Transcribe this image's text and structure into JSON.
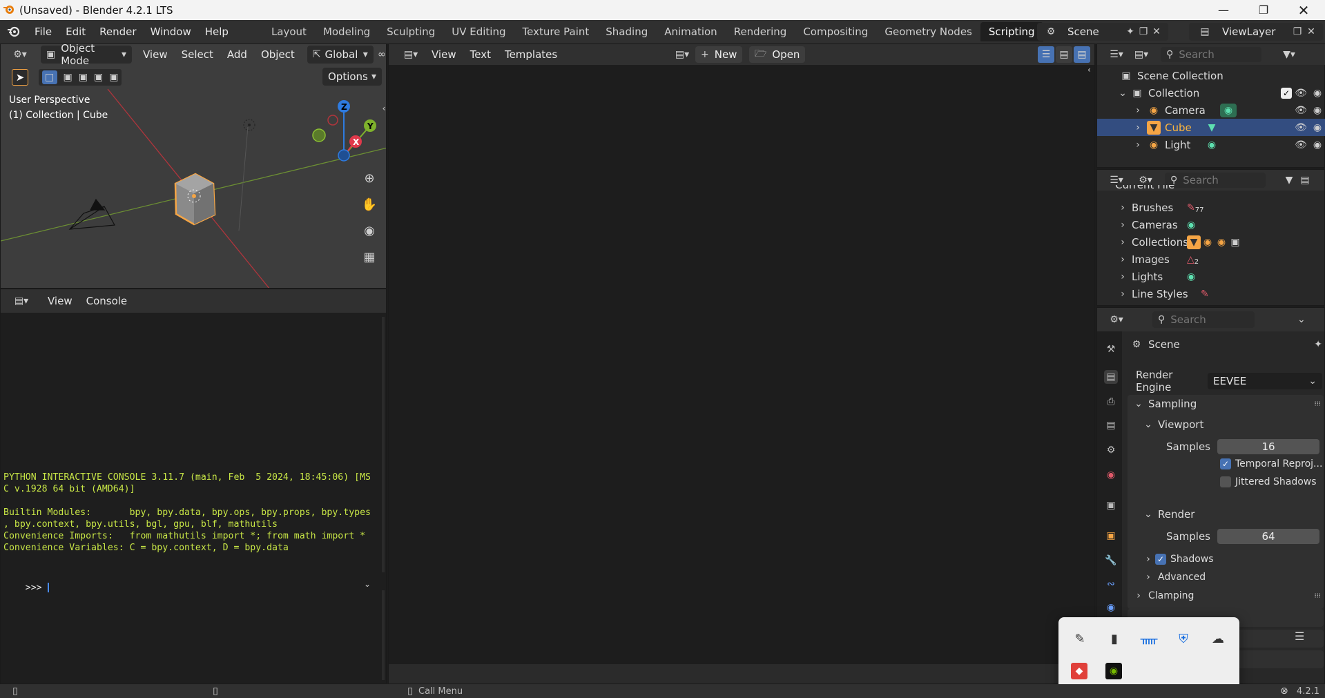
{
  "window": {
    "title": "(Unsaved) - Blender 4.2.1 LTS"
  },
  "menu": [
    "File",
    "Edit",
    "Render",
    "Window",
    "Help"
  ],
  "workspaces": [
    "Layout",
    "Modeling",
    "Sculpting",
    "UV Editing",
    "Texture Paint",
    "Shading",
    "Animation",
    "Rendering",
    "Compositing",
    "Geometry Nodes",
    "Scripting"
  ],
  "active_workspace": "Scripting",
  "scene": {
    "name": "Scene",
    "view_layer": "ViewLayer"
  },
  "viewport": {
    "mode": "Object Mode",
    "menus": [
      "View",
      "Select",
      "Add",
      "Object"
    ],
    "orientation": "Global",
    "options_label": "Options",
    "perspective_label": "User Perspective",
    "context_label": "(1) Collection | Cube"
  },
  "console": {
    "menus": [
      "View",
      "Console"
    ],
    "lines": [
      "PYTHON INTERACTIVE CONSOLE 3.11.7 (main, Feb  5 2024, 18:45:06) [MS",
      "C v.1928 64 bit (AMD64)]",
      "",
      "Builtin Modules:       bpy, bpy.data, bpy.ops, bpy.props, bpy.types",
      ", bpy.context, bpy.utils, bgl, gpu, blf, mathutils",
      "Convenience Imports:   from mathutils import *; from math import *",
      "Convenience Variables: C = bpy.context, D = bpy.data"
    ],
    "prompt": ">>> "
  },
  "text_editor": {
    "menus": [
      "View",
      "Text",
      "Templates"
    ],
    "new_label": "New",
    "open_label": "Open"
  },
  "outliner": {
    "search_placeholder": "Search",
    "scene_collection": "Scene Collection",
    "collection": "Collection",
    "items": [
      {
        "name": "Camera",
        "selected": false
      },
      {
        "name": "Cube",
        "selected": true
      },
      {
        "name": "Light",
        "selected": false
      }
    ]
  },
  "blender_file": {
    "search_placeholder": "Search",
    "current_label": "Current File",
    "items": [
      {
        "name": "Brushes",
        "badge": "77"
      },
      {
        "name": "Cameras",
        "badge": ""
      },
      {
        "name": "Collections",
        "badge": ""
      },
      {
        "name": "Images",
        "badge": "2"
      },
      {
        "name": "Lights",
        "badge": ""
      },
      {
        "name": "Line Styles",
        "badge": ""
      }
    ]
  },
  "properties": {
    "search_placeholder": "Search",
    "context_title": "Scene",
    "render_engine_label": "Render Engine",
    "render_engine_value": "EEVEE",
    "sampling_label": "Sampling",
    "viewport_label": "Viewport",
    "samples_label": "Samples",
    "viewport_samples": "16",
    "temporal_label": "Temporal Reproj...",
    "temporal_checked": true,
    "jittered_label": "Jittered Shadows",
    "jittered_checked": false,
    "render_label": "Render",
    "render_samples": "64",
    "shadows_label": "Shadows",
    "shadows_checked": true,
    "advanced_label": "Advanced",
    "clamping_label": "Clamping"
  },
  "statusbar": {
    "call_menu": "Call Menu",
    "version": "4.2.1"
  },
  "colors": {
    "accent_blue": "#4772b3",
    "selected_row": "#334d80",
    "console_text": "#c8e646",
    "cube_orange": "#f5a545"
  }
}
